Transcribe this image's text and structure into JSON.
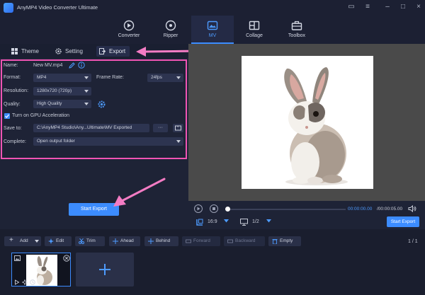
{
  "window": {
    "title": "AnyMP4 Video Converter Ultimate"
  },
  "nav": {
    "tabs": [
      {
        "label": "Converter",
        "icon": "converter-icon"
      },
      {
        "label": "Ripper",
        "icon": "ripper-icon"
      },
      {
        "label": "MV",
        "icon": "mv-icon",
        "active": true
      },
      {
        "label": "Collage",
        "icon": "collage-icon"
      },
      {
        "label": "Toolbox",
        "icon": "toolbox-icon"
      }
    ]
  },
  "subtabs": [
    {
      "label": "Theme",
      "icon": "theme-grid-icon"
    },
    {
      "label": "Setting",
      "icon": "gear-icon"
    },
    {
      "label": "Export",
      "icon": "export-icon",
      "active": true
    }
  ],
  "export": {
    "name_label": "Name:",
    "name_value": "New MV.mp4",
    "format_label": "Format:",
    "format_value": "MP4",
    "frame_rate_label": "Frame Rate:",
    "frame_rate_value": "24fps",
    "resolution_label": "Resolution:",
    "resolution_value": "1280x720 (720p)",
    "quality_label": "Quality:",
    "quality_value": "High Quality",
    "gpu_label": "Turn on GPU Acceleration",
    "gpu_checked": true,
    "save_label": "Save to:",
    "save_value": "C:\\AnyMP4 Studio\\Any...Ultimate\\MV Exported",
    "browse_label": "···",
    "complete_label": "Complete:",
    "complete_value": "Open output folder"
  },
  "start_export_label": "Start Export",
  "player": {
    "time_current": "00:00:00.00",
    "time_total": "/00:00:05.00",
    "aspect": "16:9",
    "screen": "1/2",
    "export_label": "Start Export",
    "progress": 0
  },
  "toolbar": {
    "add": "Add",
    "edit": "Edit",
    "trim": "Trim",
    "ahead": "Ahead",
    "behind": "Behind",
    "forward": "Forward",
    "backward": "Backward",
    "empty": "Empty",
    "page": "1 / 1"
  },
  "colors": {
    "accent": "#3c8cff",
    "highlight": "#f054b4"
  }
}
